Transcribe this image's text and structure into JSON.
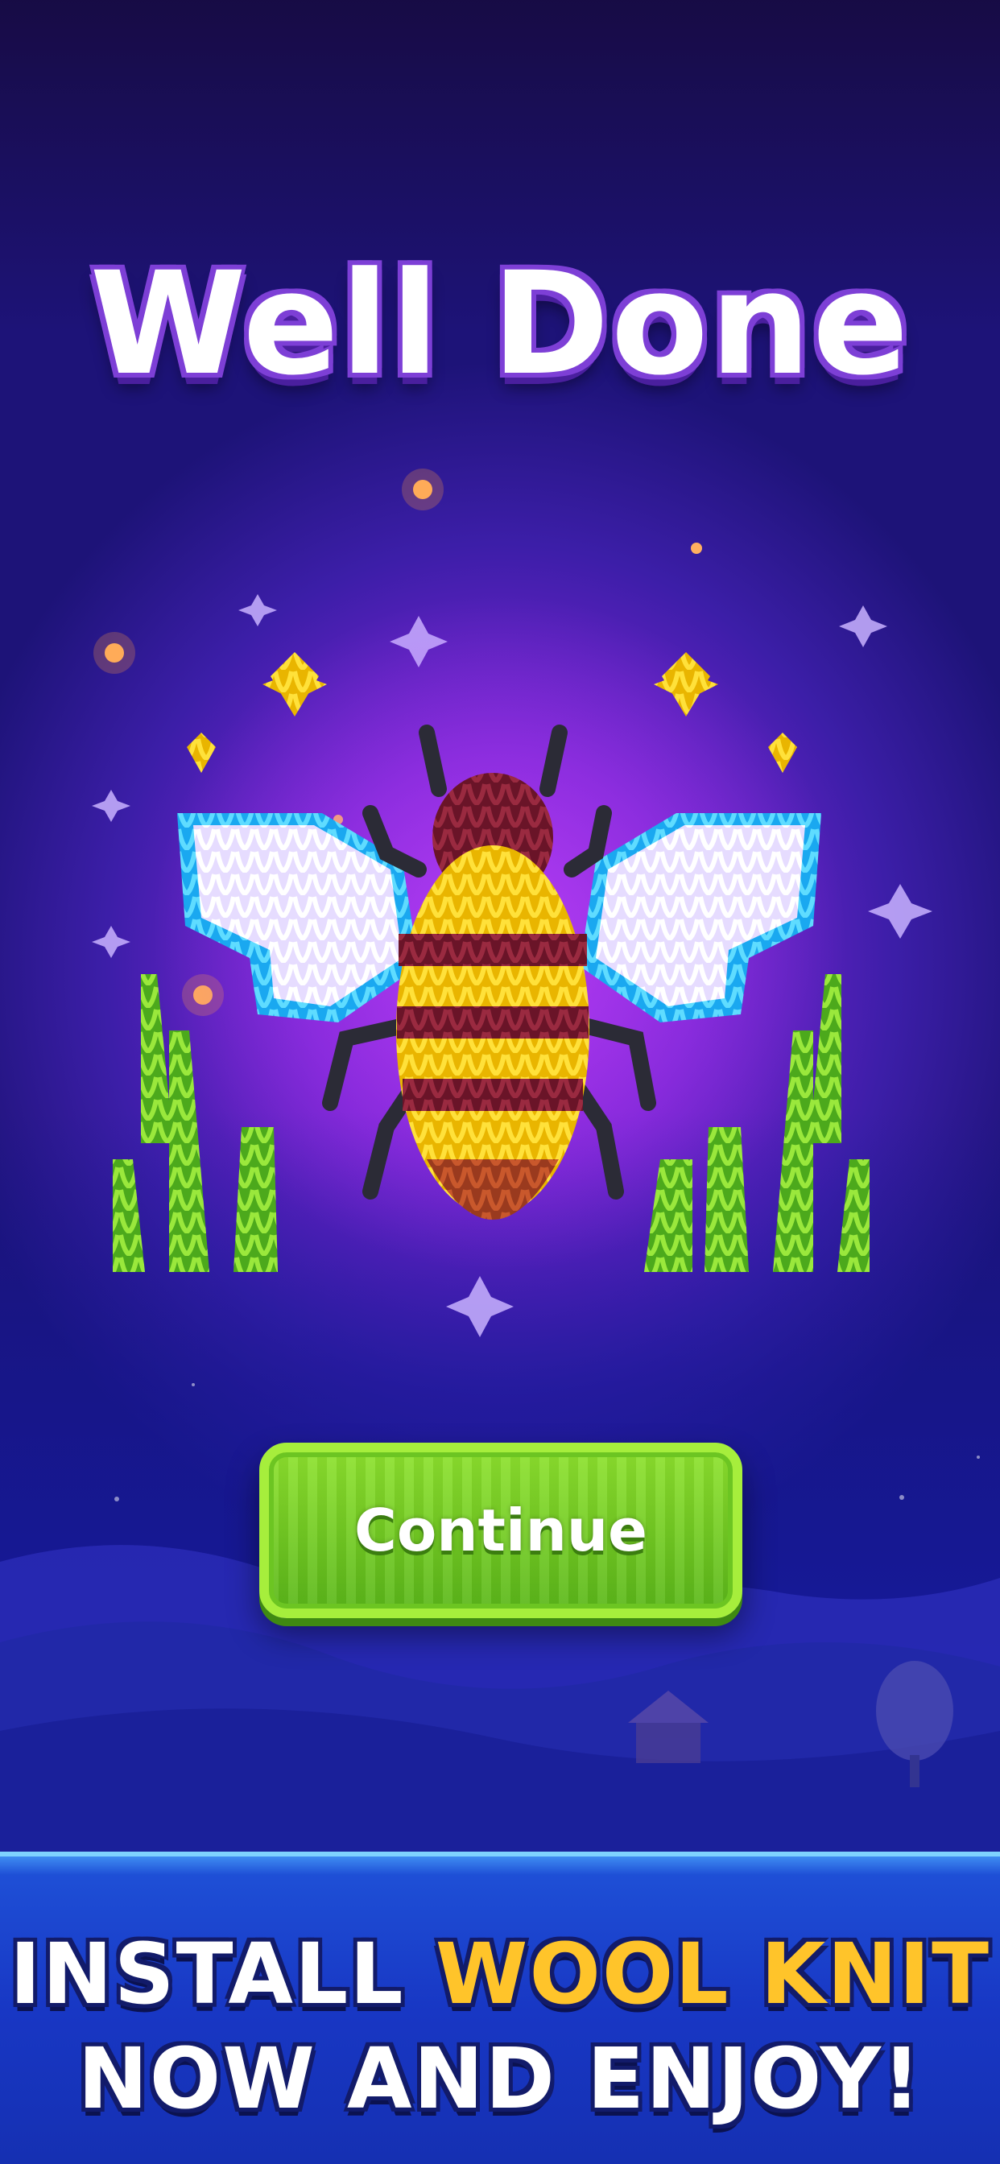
{
  "screen": {
    "title": "Well Done",
    "continue_label": "Continue"
  },
  "banner": {
    "line1_white": "INSTALL",
    "line1_gold": "WOOL KNIT",
    "line2": "NOW AND ENJOY!"
  },
  "artwork": {
    "subject": "bee-icon",
    "colors": {
      "wing_fill": "#f2eaff",
      "wing_edge": "#2cc7ff",
      "body_yellow": "#ffd21e",
      "body_red": "#8a1f33",
      "legs": "#2b2b36",
      "leaves": "#7bd332",
      "flowers": "#ffd21e"
    }
  },
  "colors": {
    "title_outline": "#7d3fd6",
    "button_green": "#7ed42a",
    "banner_blue": "#1837c4",
    "banner_gold": "#ffc42a"
  }
}
